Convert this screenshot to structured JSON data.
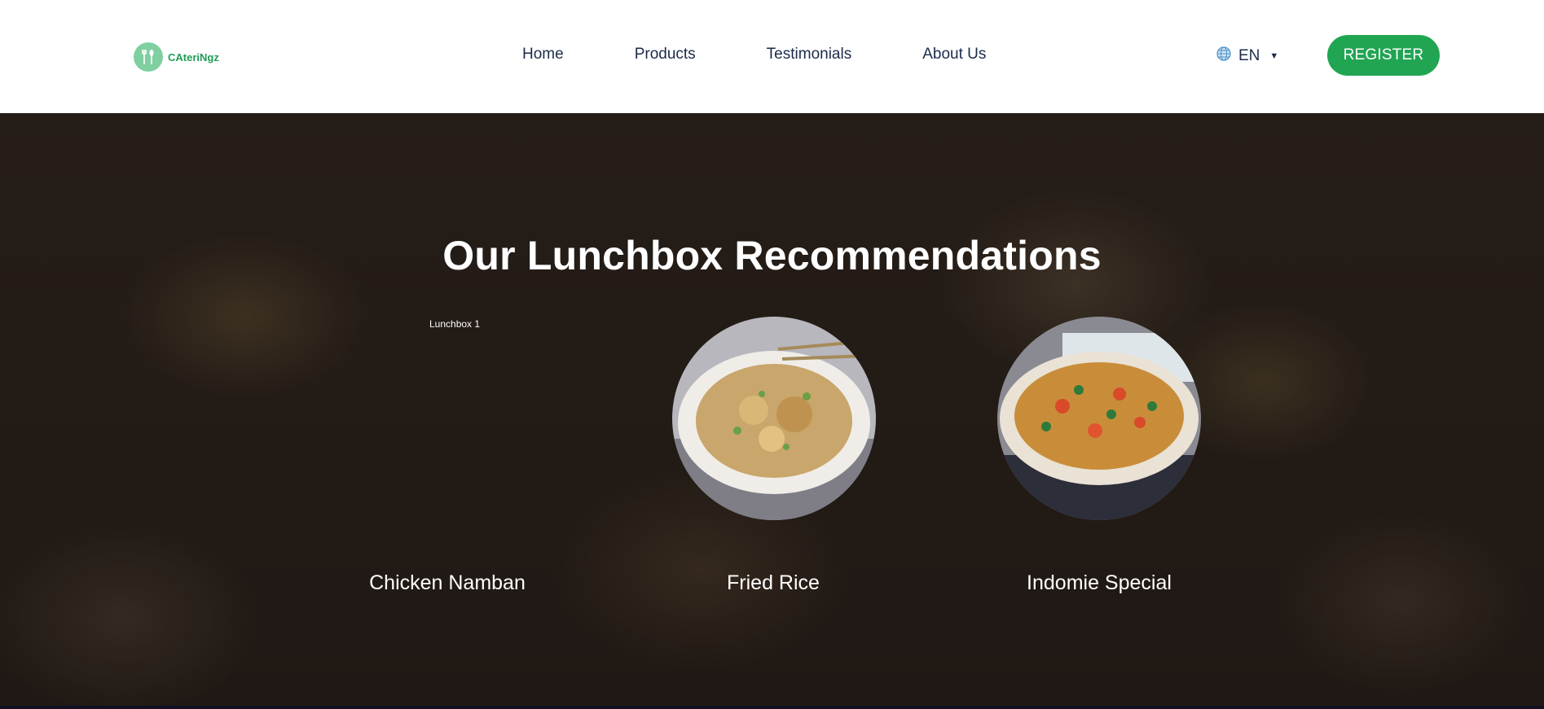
{
  "brand": {
    "name": "CAteriNgz",
    "logo_icon": "fork-spoon-icon"
  },
  "nav": {
    "items": [
      {
        "label": "Home"
      },
      {
        "label": "Products"
      },
      {
        "label": "Testimonials"
      },
      {
        "label": "About Us"
      }
    ]
  },
  "language": {
    "label": "EN",
    "icon": "globe-icon"
  },
  "register": {
    "label": "REGISTER"
  },
  "hero": {
    "title": "Our Lunchbox Recommendations",
    "first_image_alt_label": "Lunchbox 1",
    "items": [
      {
        "name": "Chicken Namban"
      },
      {
        "name": "Fried Rice"
      },
      {
        "name": "Indomie Special"
      }
    ]
  },
  "colors": {
    "accent": "#21a553",
    "nav_text": "#1b2b4a",
    "logo_green": "#7fcfa1"
  }
}
